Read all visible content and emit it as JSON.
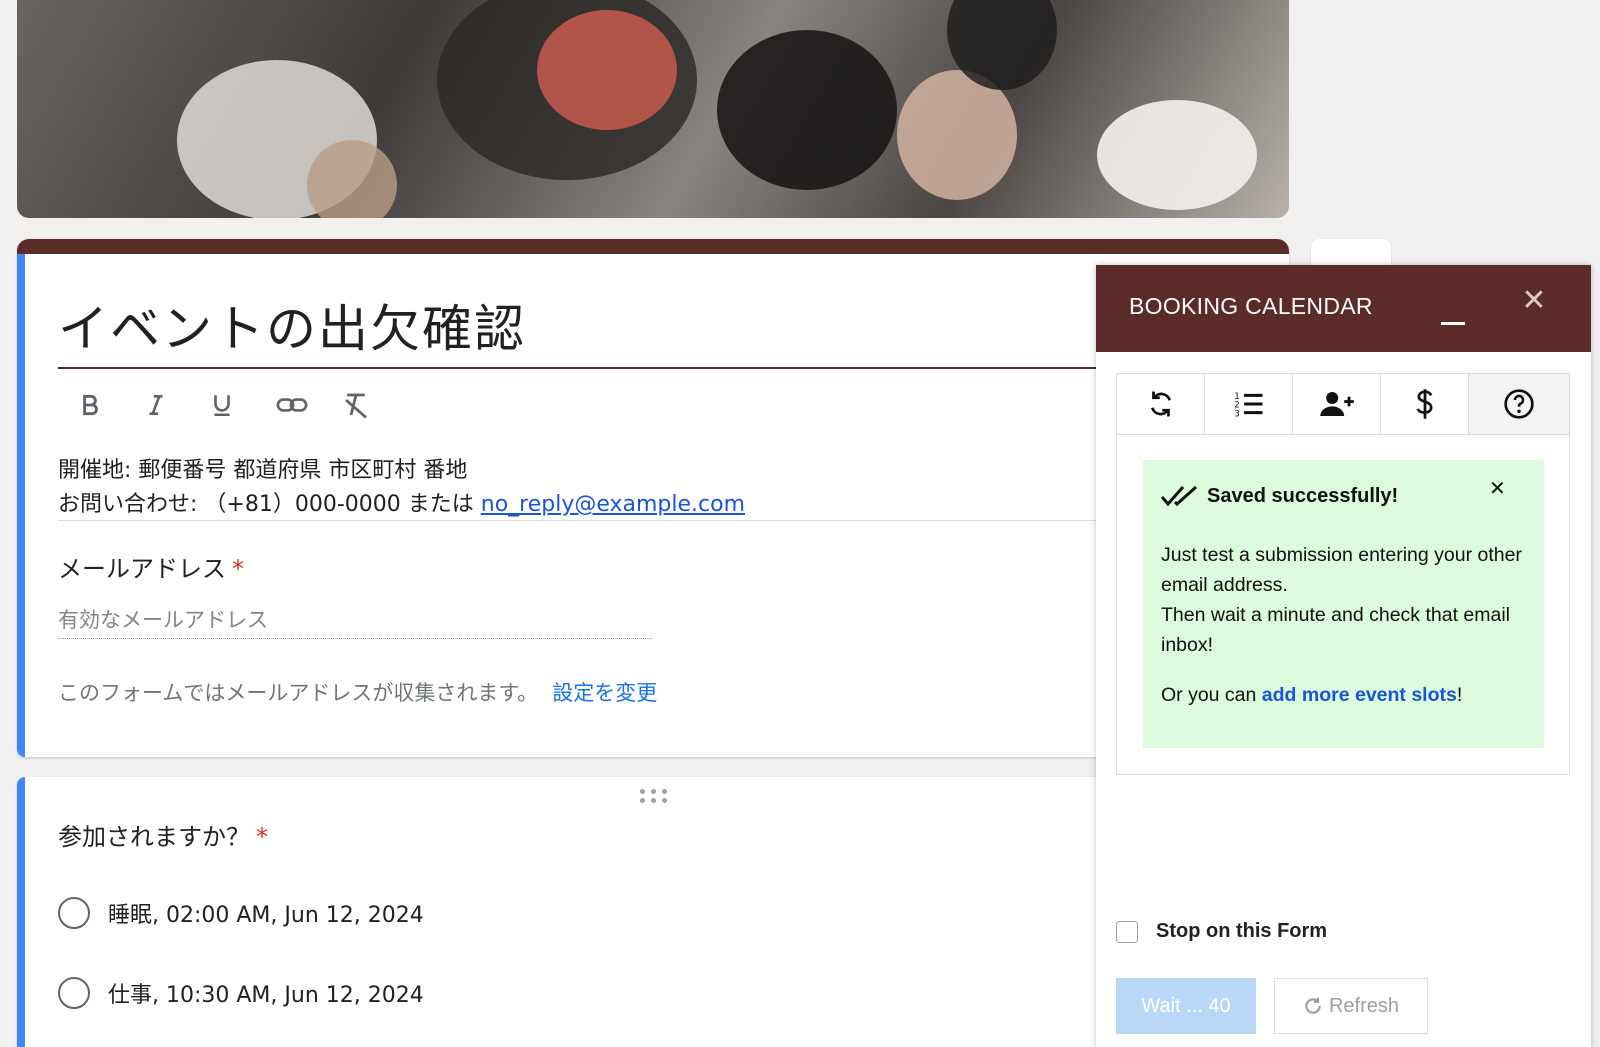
{
  "form": {
    "title": "イベントの出欠確認",
    "description_line1": "開催地: 郵便番号 都道府県 市区町村 番地",
    "description_line2_prefix": "お問い合わせ: （+81）000-0000 または ",
    "description_email": "no_reply@example.com",
    "email_label": "メールアドレス",
    "required_mark": "*",
    "email_placeholder": "有効なメールアドレス",
    "collect_notice": "このフォームではメールアドレスが収集されます。",
    "change_settings": "設定を変更",
    "toolbar_icons": [
      "bold-icon",
      "italic-icon",
      "underline-icon",
      "link-icon",
      "clear-format-icon"
    ]
  },
  "question": {
    "label": "参加されますか？",
    "required_mark": "*",
    "options": [
      "睡眠, 02:00 AM, Jun 12, 2024",
      "仕事, 10:30 AM, Jun 12, 2024"
    ]
  },
  "panel": {
    "title": "BOOKING CALENDAR",
    "tabs": [
      "sync-icon",
      "list-icon",
      "add-user-icon",
      "dollar-icon",
      "help-icon"
    ],
    "active_tab": 4,
    "alert_title": "Saved successfully!",
    "alert_line1": "Just test a submission entering your other email address.",
    "alert_line2": "Then wait a minute and check that email inbox!",
    "alert_line3_prefix": "Or you can ",
    "alert_link": "add more event slots",
    "alert_line3_suffix": "!",
    "stop_label": "Stop on this Form",
    "wait_label": "Wait ... 40",
    "refresh_label": "Refresh"
  },
  "colors": {
    "theme": "#5b2b28",
    "accent": "#4285f4",
    "alert_bg": "#dcfadc",
    "link": "#1a55d3"
  }
}
